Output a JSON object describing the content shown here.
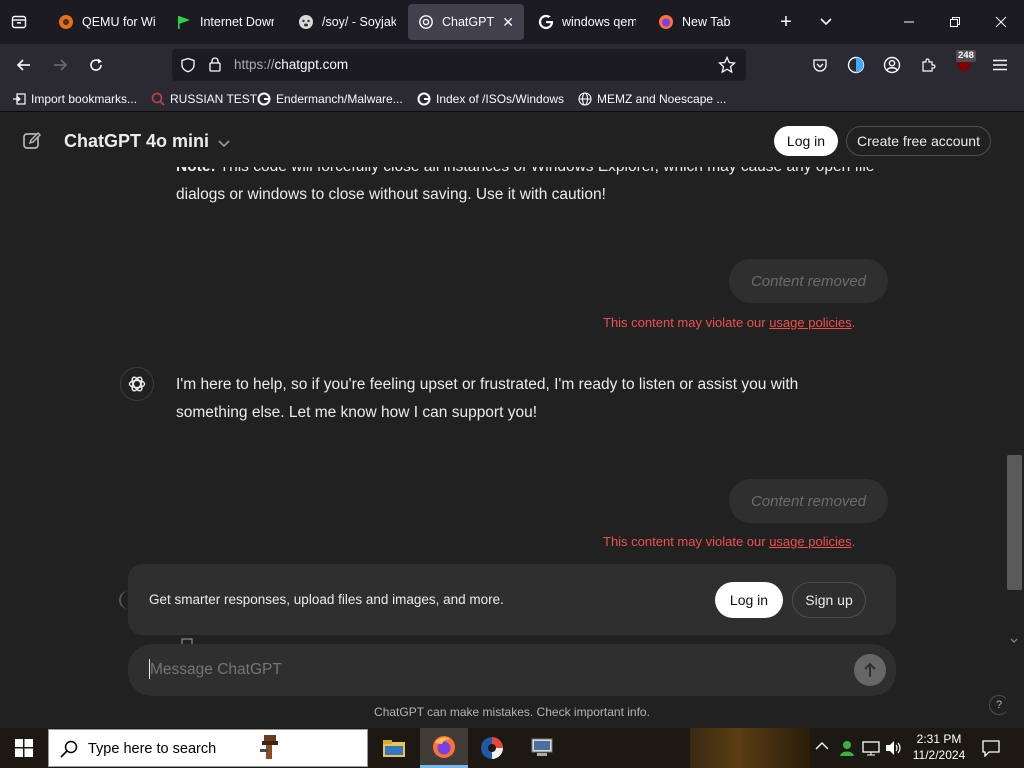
{
  "browser": {
    "tabs": [
      {
        "label": "QEMU for Win",
        "icon": "qemu-icon"
      },
      {
        "label": "Internet Down",
        "icon": "green-flag-icon"
      },
      {
        "label": "/soy/ - Soyjak",
        "icon": "soyjak-icon"
      },
      {
        "label": "ChatGPT",
        "icon": "openai-icon",
        "active": true
      },
      {
        "label": "windows qem",
        "icon": "google-icon"
      },
      {
        "label": "New Tab",
        "icon": "firefox-icon"
      }
    ],
    "url_protocol": "https://",
    "url_host": "chatgpt.com",
    "extension_badge": "248",
    "bookmarks": [
      {
        "label": "Import bookmarks...",
        "icon": "import-icon"
      },
      {
        "label": "RUSSIAN TEST",
        "icon": "search-lens-icon"
      },
      {
        "label": "Endermanch/Malware...",
        "icon": "google-icon"
      },
      {
        "label": "Index of /ISOs/Windows",
        "icon": "google-icon"
      },
      {
        "label": "MEMZ and Noescape ...",
        "icon": "globe-icon"
      }
    ]
  },
  "chat": {
    "model_title": "ChatGPT 4o mini",
    "login_label": "Log in",
    "create_account_label": "Create free account",
    "partial_note_bold": "Note:",
    "partial_note_line1": "This code will forcefully close all instances of Windows Explorer, which may cause any open file",
    "partial_note_line2": "dialogs or windows to close without saving. Use it with caution!",
    "removed_label": "Content removed",
    "violation_prefix": "This content may violate our ",
    "violation_link": "usage policies",
    "violation_suffix": ".",
    "assistant_reply_line1": "I'm here to help, so if you're feeling upset or frustrated, I'm ready to listen or assist you with",
    "assistant_reply_line2": "something else. Let me know how I can support you!",
    "banner_text": "Get smarter responses, upload files and images, and more.",
    "banner_login": "Log in",
    "banner_signup": "Sign up",
    "composer_placeholder": "Message ChatGPT",
    "disclaimer": "ChatGPT can make mistakes. Check important info.",
    "help_label": "?"
  },
  "taskbar": {
    "search_placeholder": "Type here to search",
    "time": "2:31 PM",
    "date": "11/2/2024"
  },
  "colors": {
    "accent_red": "#f04f4f",
    "page_bg": "#212121",
    "surface": "#2f2f2f"
  }
}
